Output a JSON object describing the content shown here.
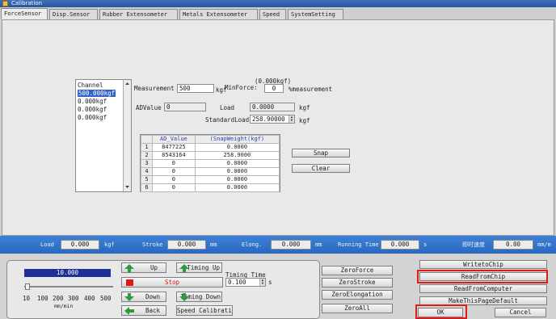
{
  "window": {
    "title": "Calibration"
  },
  "tabs": [
    {
      "label": "ForceSensor"
    },
    {
      "label": "Disp.Sensor"
    },
    {
      "label": "Rubber Extensometer"
    },
    {
      "label": "Metals Extensometer"
    },
    {
      "label": "Speed"
    },
    {
      "label": "SystemSetting"
    }
  ],
  "channel": {
    "header": "Channel",
    "items": [
      "500.000kgf",
      "0.000kgf",
      "0.000kgf",
      "0.000kgf"
    ]
  },
  "form": {
    "measurement_label": "Measurement",
    "measurement_value": "500",
    "measurement_unit": "kgf",
    "min_force_label": "MinForce:",
    "min_force_value": "0",
    "min_force_unit": "%measurement",
    "min_force_kgf": "(0.000kgf)",
    "ad_value_label": "ADValue",
    "ad_value": "0",
    "load_label": "Load",
    "load_value": "0.0000",
    "load_unit": "kgf",
    "standard_load_label": "StandardLoad",
    "standard_load_value": "258.90000",
    "standard_load_unit": "kgf"
  },
  "table": {
    "headers": [
      "AD_Value",
      "(SnapWeight(kgf)"
    ],
    "rows": [
      {
        "n": "1",
        "ad": "8477225",
        "w": "0.0000"
      },
      {
        "n": "2",
        "ad": "8543164",
        "w": "258.9000"
      },
      {
        "n": "3",
        "ad": "0",
        "w": "0.0000"
      },
      {
        "n": "4",
        "ad": "0",
        "w": "0.0000"
      },
      {
        "n": "5",
        "ad": "0",
        "w": "0.0000"
      },
      {
        "n": "6",
        "ad": "0",
        "w": "0.0000"
      }
    ]
  },
  "buttons": {
    "snap": "Snap",
    "clear": "Clear",
    "write_to_chip": "WritetoChip",
    "read_from_chip": "ReadFromChip",
    "read_from_computer": "ReadFromComputer",
    "make_default": "MakeThisPageDefault",
    "ok": "OK",
    "cancel": "Cancel",
    "zero_force": "ZeroForce",
    "zero_stroke": "ZeroStroke",
    "zero_elongation": "ZeroElongation",
    "zero_all": "ZeroAll",
    "up": "Up",
    "timing_up": "Timing Up",
    "stop": "Stop",
    "down": "Down",
    "timing_down": "Timing Down",
    "back": "Back",
    "speed_calibration": "Speed Calibration"
  },
  "status": {
    "load_label": "Load",
    "load_value": "0.000",
    "load_unit": "kgf",
    "stroke_label": "Stroke",
    "stroke_value": "0.000",
    "stroke_unit": "mm",
    "elong_label": "Elong.",
    "elong_value": "0.000",
    "elong_unit": "mm",
    "running_time_label": "Running Time",
    "running_time_value": "0.000",
    "running_time_unit": "s",
    "speed_label": "即时速度",
    "speed_value": "0.00",
    "speed_unit": "mm/m"
  },
  "control": {
    "speed_value": "10.000",
    "speed_ticks": [
      "10",
      "100",
      "200",
      "300",
      "400",
      "500"
    ],
    "speed_unit": "mm/min",
    "timing_time_label": "Timing Time",
    "timing_time_value": "0.100",
    "timing_time_unit": "s"
  },
  "colors": {
    "accent": "#2f63c9",
    "status_bar": "#2f74cc",
    "highlight": "#e21a1a",
    "stop": "#e01818"
  }
}
